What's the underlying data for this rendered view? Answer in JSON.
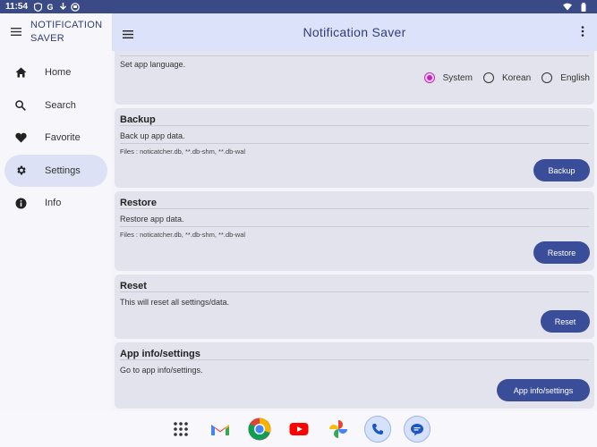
{
  "status": {
    "time": "11:54"
  },
  "drawer": {
    "title_line1": "NOTIFICATION",
    "title_line2": "SAVER",
    "items": [
      {
        "label": "Home",
        "icon": "home-icon"
      },
      {
        "label": "Search",
        "icon": "search-icon"
      },
      {
        "label": "Favorite",
        "icon": "heart-icon"
      },
      {
        "label": "Settings",
        "icon": "gear-icon"
      },
      {
        "label": "Info",
        "icon": "info-icon"
      }
    ]
  },
  "appbar": {
    "title": "Notification Saver"
  },
  "language": {
    "desc": "Set app language.",
    "options": [
      "System",
      "Korean",
      "English"
    ],
    "selected": "System"
  },
  "backup": {
    "title": "Backup",
    "desc": "Back up app data.",
    "files": "Files : noticatcher.db, **.db-shm, **.db-wal",
    "button": "Backup"
  },
  "restore": {
    "title": "Restore",
    "desc": "Restore app data.",
    "files": "Files : noticatcher.db, **.db-shm, **.db-wal",
    "button": "Restore"
  },
  "reset": {
    "title": "Reset",
    "desc": "This will reset all settings/data.",
    "button": "Reset"
  },
  "appinfo": {
    "title": "App info/settings",
    "desc": "Go to app info/settings.",
    "button": "App info/settings"
  },
  "colors": {
    "accent": "#3a4d98",
    "radio": "#d418c8",
    "appbar": "#dde2fb",
    "statusbar": "#3a4a86"
  }
}
